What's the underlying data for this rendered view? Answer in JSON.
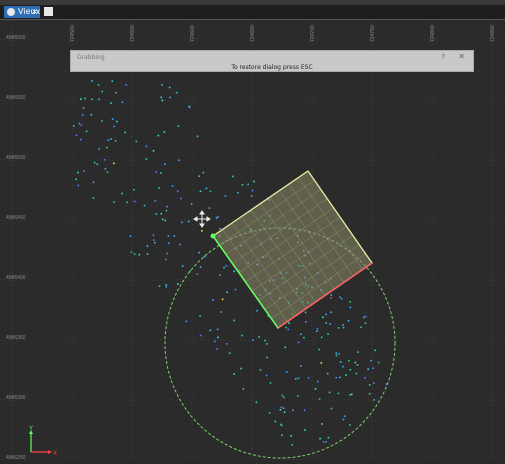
{
  "tab": {
    "label": "Vieux"
  },
  "dialog": {
    "title": "Grabbing",
    "message": "To restore dialog press ESC",
    "help_label": "?",
    "close_label": "✕"
  },
  "axis_tick_labels": {
    "top": [
      "724500",
      "724550",
      "724600",
      "724650",
      "724700",
      "724750",
      "724800",
      "724850"
    ],
    "left": [
      "4986600",
      "4986550",
      "4986500",
      "4986450",
      "4986400",
      "4986350",
      "4986300",
      "4986250"
    ]
  },
  "gizmo": {
    "x_label": "X",
    "y_label": "Y"
  },
  "colors": {
    "view_bg": "#2b2b2b",
    "box_edge": "#e8f0a0",
    "box_fill": "#8a8a68",
    "circle": "#7fd36a",
    "axis_x": "#ff4040",
    "axis_y": "#60ff60"
  },
  "cursor_icon": "move-cross-icon"
}
